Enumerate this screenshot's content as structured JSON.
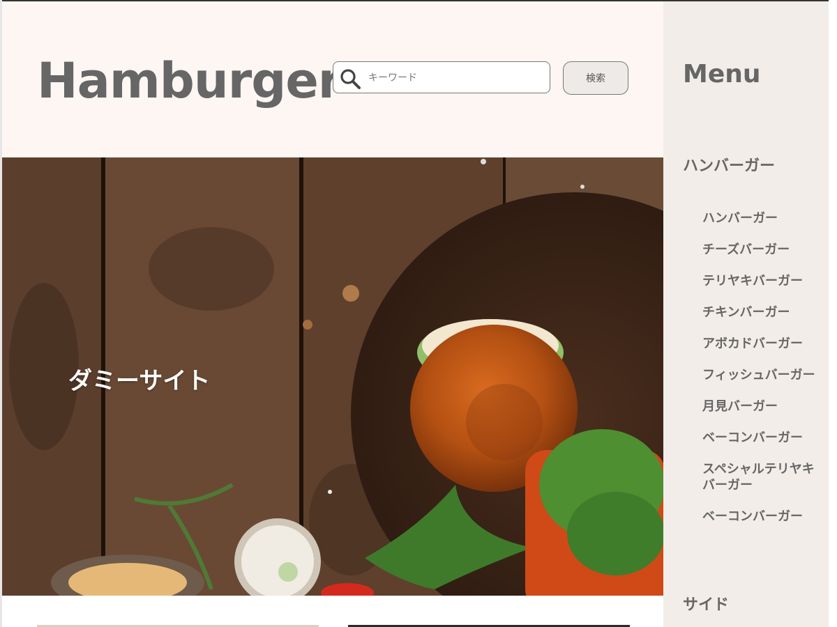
{
  "header": {
    "site_title": "Hamburger",
    "search": {
      "placeholder": "キーワード",
      "button_label": "検索"
    }
  },
  "hero": {
    "caption": "ダミーサイト"
  },
  "sidebar": {
    "title": "Menu",
    "categories": [
      {
        "label": "ハンバーガー",
        "items": [
          "ハンバーガー",
          "チーズバーガー",
          "テリヤキバーガー",
          "チキンバーガー",
          "アボカドバーガー",
          "フィッシュバーガー",
          "月見バーガー",
          "ベーコンバーガー",
          "スペシャルテリヤキバーガー",
          "ベーコンバーガー"
        ]
      },
      {
        "label": "サイド"
      }
    ]
  },
  "colors": {
    "header_bg": "#fdf6f2",
    "sidebar_bg": "#f2ede9",
    "text": "#666666",
    "wood": "#5a3e2b"
  },
  "icons": {
    "search": "search-icon"
  }
}
